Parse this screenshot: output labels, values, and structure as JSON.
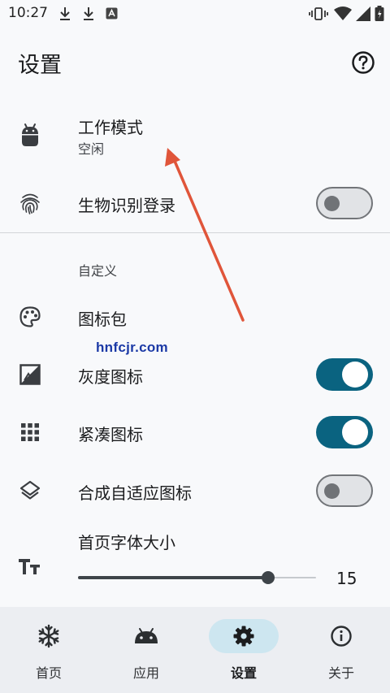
{
  "status_bar": {
    "time": "10:27"
  },
  "page": {
    "title": "设置"
  },
  "settings": {
    "work_mode": {
      "title": "工作模式",
      "value": "空闲"
    },
    "biometric": {
      "title": "生物识别登录",
      "enabled": false
    },
    "section_custom": "自定义",
    "icon_pack": {
      "title": "图标包"
    },
    "grayscale_icons": {
      "title": "灰度图标",
      "enabled": true
    },
    "compact_icons": {
      "title": "紧凑图标",
      "enabled": true
    },
    "adaptive_icons": {
      "title": "合成自适应图标",
      "enabled": false
    },
    "font_size": {
      "title": "首页字体大小",
      "value": "15",
      "fraction": 0.8
    }
  },
  "watermark": "hnfcjr.com",
  "bottom_nav": [
    {
      "label": "首页",
      "icon": "snowflake-icon",
      "active": false
    },
    {
      "label": "应用",
      "icon": "android-icon",
      "active": false
    },
    {
      "label": "设置",
      "icon": "gear-icon",
      "active": true
    },
    {
      "label": "关于",
      "icon": "info-icon",
      "active": false
    }
  ],
  "colors": {
    "accent": "#0a6380",
    "nav_active_pill": "#cde6f0",
    "background": "#f8f9fb",
    "arrow": "#e0553a"
  }
}
